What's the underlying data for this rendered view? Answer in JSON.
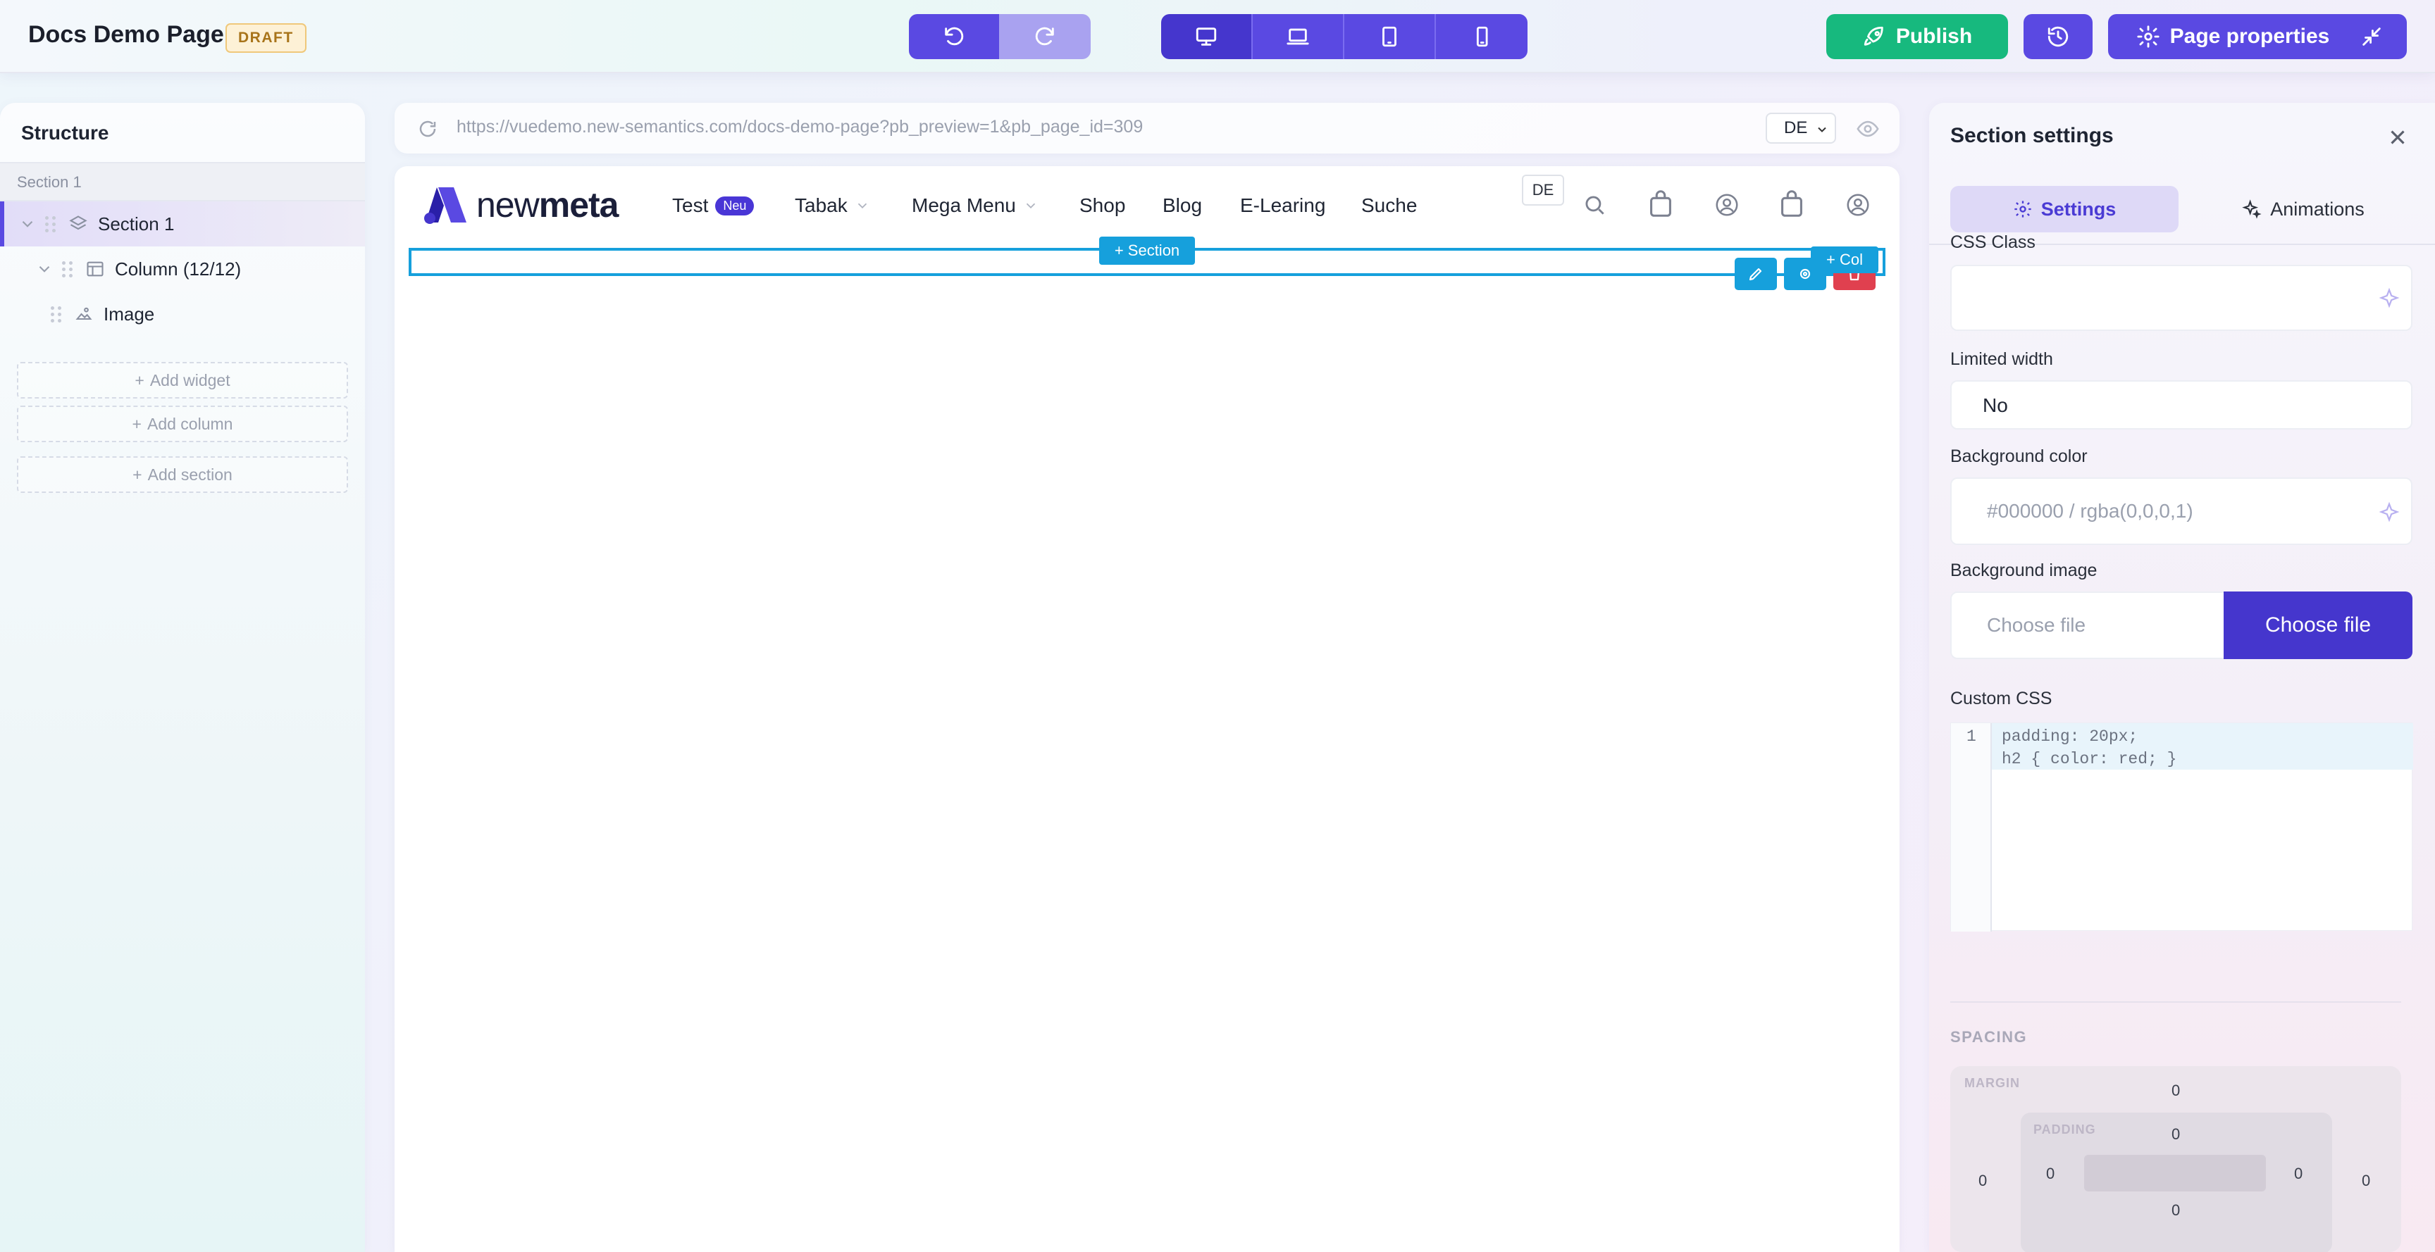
{
  "header": {
    "title": "Docs Demo Page",
    "status_badge": "DRAFT",
    "publish_label": "Publish",
    "page_properties_label": "Page properties"
  },
  "structure": {
    "heading": "Structure",
    "group_label": "Section 1",
    "items": [
      {
        "label": "Section 1",
        "type": "section"
      },
      {
        "label": "Column (12/12)",
        "type": "column"
      },
      {
        "label": "Image",
        "type": "image"
      }
    ],
    "add_widget": "Add widget",
    "add_column": "Add column",
    "add_section": "Add section"
  },
  "preview": {
    "url": "https://vuedemo.new-semantics.com/docs-demo-page?pb_preview=1&pb_page_id=309",
    "language": "DE",
    "logo_text_light": "new",
    "logo_text_bold": "meta",
    "nav": [
      {
        "label": "Test",
        "badge": "Neu"
      },
      {
        "label": "Tabak"
      },
      {
        "label": "Mega Menu"
      },
      {
        "label": "Shop"
      },
      {
        "label": "Blog"
      },
      {
        "label": "E-Learing"
      },
      {
        "label": "Suche"
      }
    ],
    "lang_badge": "DE",
    "add_section_tag": "+ Section",
    "add_col_tag": "+ Col"
  },
  "settings": {
    "title": "Section settings",
    "tab_settings": "Settings",
    "tab_animations": "Animations",
    "css_class_label": "CSS Class",
    "css_class_value": "",
    "limited_width_label": "Limited width",
    "limited_width_value": "No",
    "bg_color_label": "Background color",
    "bg_color_placeholder": "#000000 / rgba(0,0,0,1)",
    "bg_image_label": "Background image",
    "bg_image_placeholder": "Choose file",
    "bg_image_button": "Choose file",
    "custom_css_label": "Custom CSS",
    "code_line_number": "1",
    "code_lines": [
      "padding: 20px;",
      "h2 { color: red; }"
    ],
    "spacing_heading": "SPACING",
    "margin_label": "MARGIN",
    "padding_label": "PADDING",
    "margin": {
      "top": "0",
      "left": "0",
      "right": "0"
    },
    "padding": {
      "top": "0",
      "left": "0",
      "right": "0",
      "bottom": "0"
    }
  },
  "colors": {
    "accent": "#5a49e2",
    "publish": "#17b97e",
    "selection": "#16a0dc",
    "danger": "#e0404f"
  }
}
